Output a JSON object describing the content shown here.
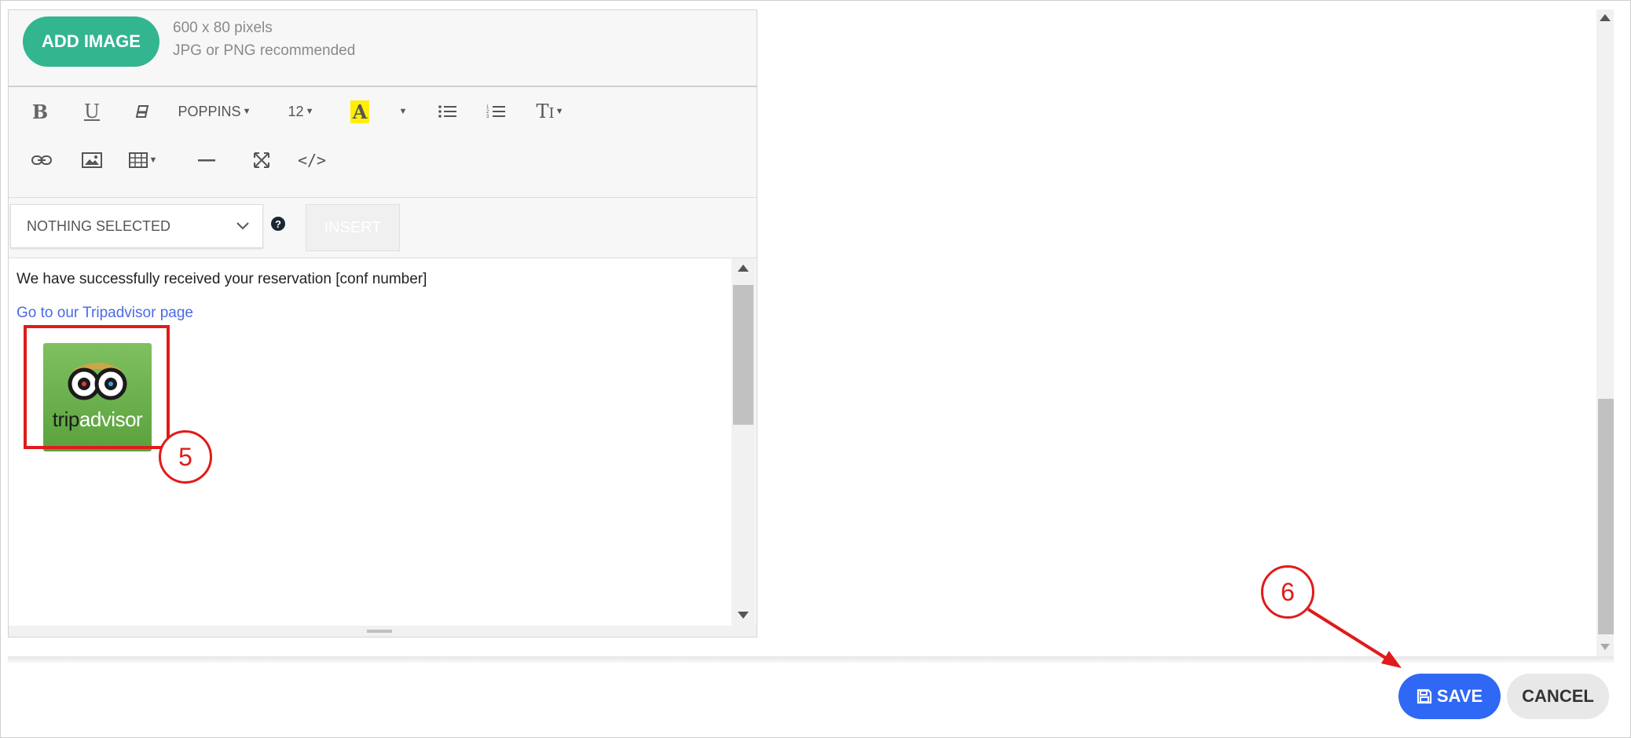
{
  "image_panel": {
    "add_image_label": "ADD IMAGE",
    "size_hint": "600 x 80 pixels",
    "format_hint": "JPG or PNG recommended"
  },
  "toolbar": {
    "font_label": "POPPINS",
    "size_label": "12",
    "highlight_color": "#ffee00"
  },
  "insert_row": {
    "select_label": "NOTHING SELECTED",
    "insert_label": "INSERT"
  },
  "content": {
    "body_text": "We have successfully received your reservation [conf number]",
    "link_text": "Go to our Tripadvisor page",
    "logo_text_dark": "trip",
    "logo_text_light": "advisor"
  },
  "footer": {
    "save_label": "SAVE",
    "cancel_label": "CANCEL"
  },
  "annotations": {
    "step5": "5",
    "step6": "6"
  },
  "colors": {
    "accent_green": "#33b58f",
    "save_blue": "#2f68f5",
    "annotation_red": "#e01b1b",
    "link_blue": "#4a6ae6"
  }
}
